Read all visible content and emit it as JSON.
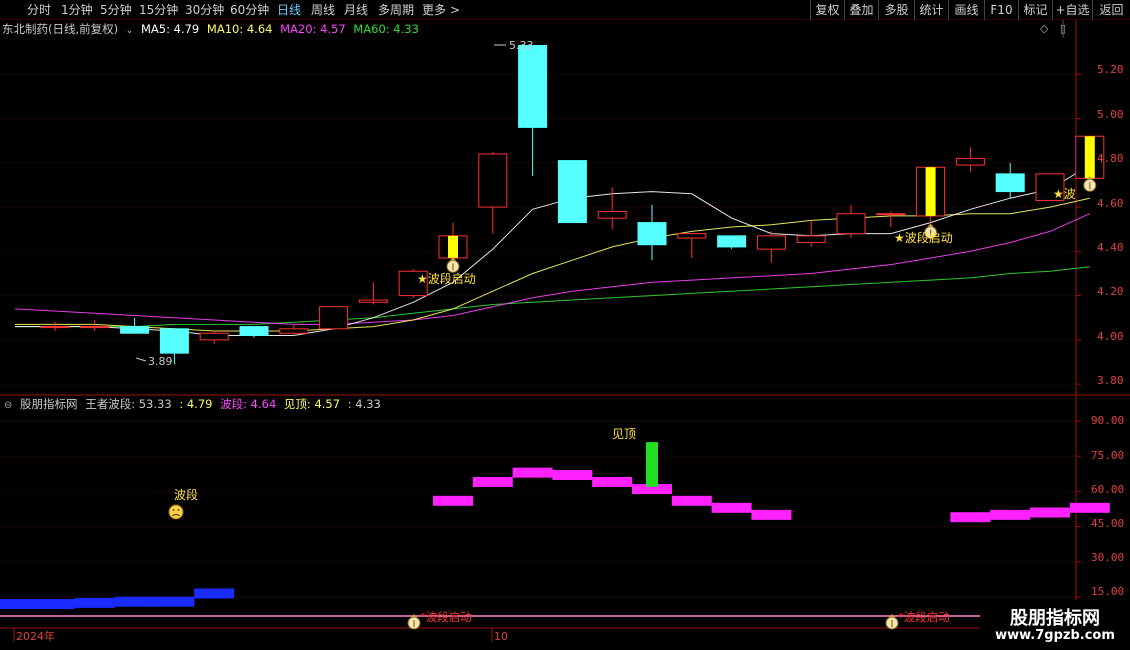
{
  "toolbar": {
    "periods": [
      "分时",
      "1分钟",
      "5分钟",
      "15分钟",
      "30分钟",
      "60分钟",
      "日线",
      "周线",
      "月线",
      "多周期",
      "更多"
    ],
    "active_period": "日线",
    "more_arrow": ">",
    "actions": [
      "复权",
      "叠加",
      "多股",
      "统计",
      "画线",
      "F10",
      "标记",
      "+自选",
      "返回"
    ]
  },
  "main_chart": {
    "stock_label": "东北制药(日线,前复权)",
    "ma": [
      {
        "label": "MA5: 4.79",
        "color": "#ffffff"
      },
      {
        "label": "MA10: 4.64",
        "color": "#ffff66"
      },
      {
        "label": "MA20: 4.57",
        "color": "#ff44ff"
      },
      {
        "label": "MA60: 4.33",
        "color": "#33dd33"
      }
    ],
    "y_ticks": [
      "5.20",
      "5.00",
      "4.80",
      "4.60",
      "4.40",
      "4.20",
      "4.00",
      "3.80"
    ],
    "high_label": "5.33",
    "low_label": "3.89",
    "signal_label": "★波段启动",
    "last_signal_label": "★波",
    "icons": [
      "money-bag-icon",
      "diamond-icon",
      "panel-icon"
    ]
  },
  "sub_chart": {
    "title": "股朋指标网",
    "indicator_name": "王者波段:",
    "values": [
      {
        "label": "53.33",
        "color": "#c8c8c8"
      },
      {
        "label": ": 4.79",
        "color": "#ffff66"
      },
      {
        "label": "波段: 4.64",
        "color": "#ff44ff"
      },
      {
        "label": "见顶: 4.57",
        "color": "#ffff66"
      },
      {
        "label": ": 4.33",
        "color": "#c8c8c8"
      }
    ],
    "y_ticks": [
      "90.00",
      "75.00",
      "60.00",
      "45.00",
      "30.00",
      "15.00"
    ],
    "top_label": "见顶",
    "wave_label": "波段",
    "start_label": "*波段启动"
  },
  "x_axis": {
    "labels": [
      "2024年",
      "10"
    ]
  },
  "watermark": {
    "title": "股朋指标网",
    "url": "www.7gpzb.com"
  },
  "chart_data": {
    "type": "candlestick",
    "candles": [
      {
        "o": 4.06,
        "c": 4.06,
        "h": 4.08,
        "l": 4.04
      },
      {
        "o": 4.06,
        "c": 4.06,
        "h": 4.09,
        "l": 4.04
      },
      {
        "o": 4.06,
        "c": 4.03,
        "h": 4.1,
        "l": 4.03
      },
      {
        "o": 4.05,
        "c": 3.94,
        "h": 4.05,
        "l": 3.89
      },
      {
        "o": 4.0,
        "c": 4.03,
        "h": 4.04,
        "l": 3.98
      },
      {
        "o": 4.06,
        "c": 4.02,
        "h": 4.06,
        "l": 4.01
      },
      {
        "o": 4.03,
        "c": 4.05,
        "h": 4.07,
        "l": 4.02
      },
      {
        "o": 4.05,
        "c": 4.15,
        "h": 4.15,
        "l": 4.05
      },
      {
        "o": 4.17,
        "c": 4.18,
        "h": 4.26,
        "l": 4.16
      },
      {
        "o": 4.2,
        "c": 4.31,
        "h": 4.32,
        "l": 4.19
      },
      {
        "o": 4.37,
        "c": 4.47,
        "h": 4.53,
        "l": 4.33
      },
      {
        "o": 4.6,
        "c": 4.84,
        "h": 4.85,
        "l": 4.48
      },
      {
        "o": 5.33,
        "c": 4.96,
        "h": 5.33,
        "l": 4.74
      },
      {
        "o": 4.81,
        "c": 4.53,
        "h": 4.81,
        "l": 4.53
      },
      {
        "o": 4.55,
        "c": 4.58,
        "h": 4.69,
        "l": 4.5
      },
      {
        "o": 4.53,
        "c": 4.43,
        "h": 4.61,
        "l": 4.36
      },
      {
        "o": 4.46,
        "c": 4.48,
        "h": 4.48,
        "l": 4.37
      },
      {
        "o": 4.47,
        "c": 4.42,
        "h": 4.47,
        "l": 4.41
      },
      {
        "o": 4.41,
        "c": 4.47,
        "h": 4.49,
        "l": 4.35
      },
      {
        "o": 4.44,
        "c": 4.47,
        "h": 4.54,
        "l": 4.42
      },
      {
        "o": 4.48,
        "c": 4.57,
        "h": 4.61,
        "l": 4.46
      },
      {
        "o": 4.57,
        "c": 4.57,
        "h": 4.58,
        "l": 4.51
      },
      {
        "o": 4.56,
        "c": 4.78,
        "h": 4.78,
        "l": 4.53
      },
      {
        "o": 4.79,
        "c": 4.82,
        "h": 4.87,
        "l": 4.76
      },
      {
        "o": 4.75,
        "c": 4.67,
        "h": 4.8,
        "l": 4.64
      },
      {
        "o": 4.63,
        "c": 4.75,
        "h": 4.75,
        "l": 4.63
      },
      {
        "o": 4.73,
        "c": 4.92,
        "h": 4.92,
        "l": 4.73
      }
    ],
    "highlight_candles": [
      10,
      22,
      26
    ],
    "ma5": [
      4.06,
      4.06,
      4.05,
      4.04,
      4.02,
      4.02,
      4.02,
      4.05,
      4.1,
      4.17,
      4.26,
      4.41,
      4.59,
      4.64,
      4.66,
      4.67,
      4.66,
      4.55,
      4.48,
      4.47,
      4.48,
      4.48,
      4.53,
      4.59,
      4.64,
      4.68,
      4.79
    ],
    "ma10": [
      4.07,
      4.07,
      4.06,
      4.05,
      4.04,
      4.04,
      4.04,
      4.05,
      4.06,
      4.09,
      4.14,
      4.22,
      4.3,
      4.36,
      4.42,
      4.46,
      4.49,
      4.51,
      4.52,
      4.54,
      4.55,
      4.56,
      4.56,
      4.57,
      4.57,
      4.6,
      4.64
    ],
    "ma20": [
      4.14,
      4.12,
      4.11,
      4.1,
      4.09,
      4.08,
      4.07,
      4.07,
      4.08,
      4.09,
      4.11,
      4.15,
      4.19,
      4.22,
      4.24,
      4.26,
      4.27,
      4.28,
      4.29,
      4.3,
      4.32,
      4.34,
      4.37,
      4.4,
      4.44,
      4.49,
      4.57
    ],
    "ma60": [
      4.06,
      4.06,
      4.06,
      4.07,
      4.07,
      4.07,
      4.08,
      4.09,
      4.1,
      4.12,
      4.14,
      4.16,
      4.17,
      4.18,
      4.19,
      4.2,
      4.21,
      4.22,
      4.23,
      4.24,
      4.25,
      4.26,
      4.27,
      4.28,
      4.3,
      4.31,
      4.33
    ],
    "y_range": [
      3.76,
      5.4
    ],
    "sub_bars": [
      {
        "i": 0,
        "v": 12,
        "color": "#1a2bff"
      },
      {
        "i": 1,
        "v": 12.5,
        "color": "#1a2bff"
      },
      {
        "i": 2,
        "v": 13,
        "color": "#1a2bff"
      },
      {
        "i": 3,
        "v": 13,
        "color": "#1a2bff"
      },
      {
        "i": 4,
        "v": 16.5,
        "color": "#1a2bff"
      },
      {
        "i": 10,
        "v": 56,
        "color": "#ff22ff"
      },
      {
        "i": 11,
        "v": 64,
        "color": "#ff22ff"
      },
      {
        "i": 12,
        "v": 68,
        "color": "#ff22ff"
      },
      {
        "i": 13,
        "v": 67,
        "color": "#ff22ff"
      },
      {
        "i": 14,
        "v": 64,
        "color": "#ff22ff"
      },
      {
        "i": 15,
        "v": 61,
        "color": "#ff22ff"
      },
      {
        "i": 16,
        "v": 56,
        "color": "#ff22ff"
      },
      {
        "i": 17,
        "v": 53,
        "color": "#ff22ff"
      },
      {
        "i": 18,
        "v": 50,
        "color": "#ff22ff"
      },
      {
        "i": 23,
        "v": 49,
        "color": "#ff22ff"
      },
      {
        "i": 24,
        "v": 50,
        "color": "#ff22ff"
      },
      {
        "i": 25,
        "v": 51,
        "color": "#ff22ff"
      },
      {
        "i": 26,
        "v": 53,
        "color": "#ff22ff"
      }
    ],
    "top_bar": {
      "i": 15,
      "from": 62,
      "to": 81
    },
    "sub_range": [
      10,
      100
    ]
  }
}
